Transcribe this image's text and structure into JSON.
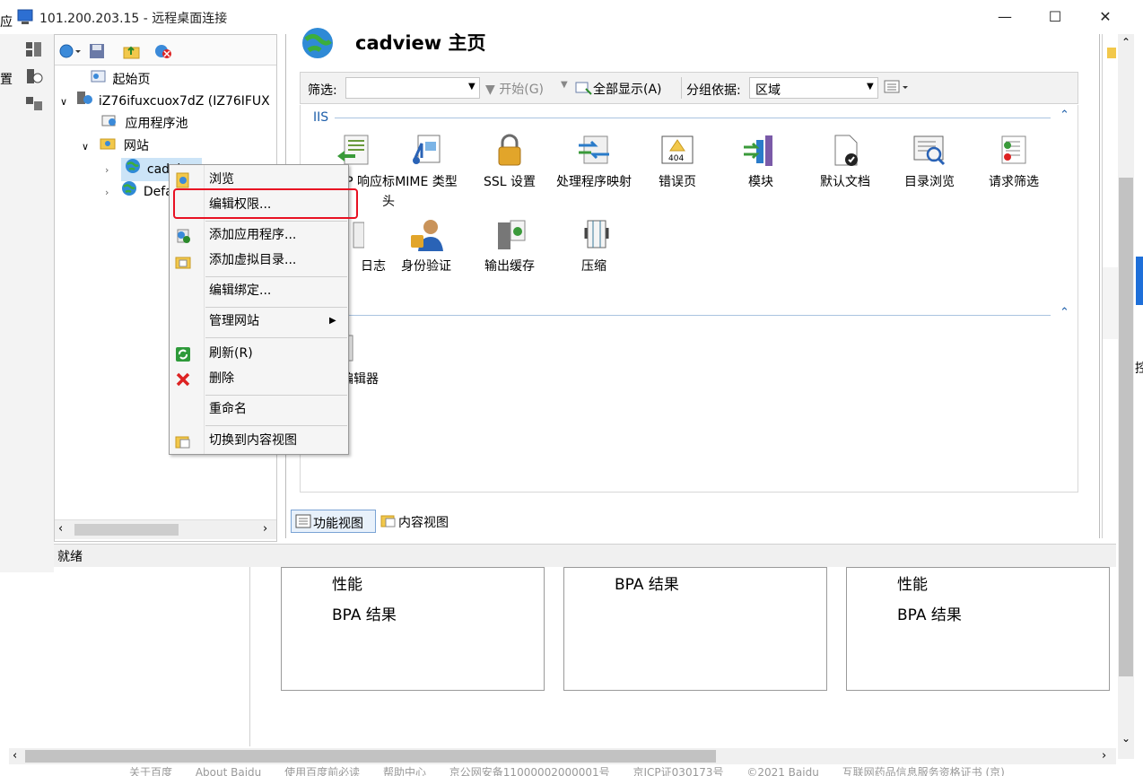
{
  "window": {
    "title": "101.200.203.15 - 远程桌面连接",
    "left_edge_chars": [
      "应",
      "置"
    ],
    "right_edge_char": "控"
  },
  "tree": {
    "start_page": "起始页",
    "server": "iZ76ifuxcuox7dZ (IZ76IFUX",
    "app_pools": "应用程序池",
    "sites": "网站",
    "site1": "cadview",
    "site2": "Default"
  },
  "main": {
    "title": "cadview 主页",
    "filter_label": "筛选:",
    "start_btn": "开始(G)",
    "show_all_btn": "全部显示(A)",
    "group_label": "分组依据:",
    "group_value": "区域",
    "section_iis": "IIS",
    "features": [
      "HTTP 响应标头",
      "MIME 类型",
      "SSL 设置",
      "处理程序映射",
      "错误页",
      "模块",
      "默认文档",
      "目录浏览",
      "请求筛选",
      "日志",
      "身份验证",
      "输出缓存",
      "压缩"
    ],
    "section2_item": "配置编辑器",
    "tab_feature": "功能视图",
    "tab_content": "内容视图"
  },
  "status": {
    "text": "就绪"
  },
  "context_menu": {
    "items": [
      "浏览",
      "编辑权限...",
      "添加应用程序...",
      "添加虚拟目录...",
      "编辑绑定...",
      "管理网站",
      "刷新(R)",
      "删除",
      "重命名",
      "切换到内容视图"
    ],
    "highlighted_index": 1,
    "highlight_color": "#e81123"
  },
  "bpa": {
    "card1": [
      "性能",
      "BPA 结果"
    ],
    "card2": [
      "BPA 结果"
    ],
    "card3": [
      "性能",
      "BPA 结果"
    ]
  },
  "footer": {
    "links": [
      "关于百度",
      "About Baidu",
      "使用百度前必读",
      "帮助中心",
      "京公网安备11000002000001号",
      "京ICP证030173号",
      "©2021 Baidu",
      "互联网药品信息服务资格证书 (京)"
    ]
  },
  "colors": {
    "accent_blue": "#1e6fd9",
    "window_bg": "#ffffff",
    "panel_bg": "#f0f0f0"
  }
}
